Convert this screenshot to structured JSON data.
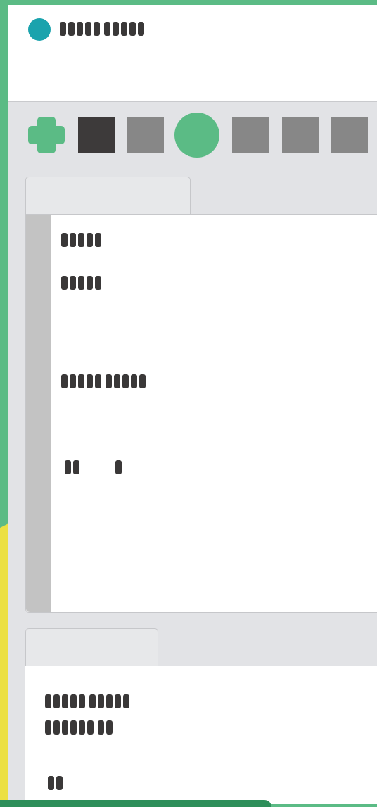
{
  "window": {
    "title": "▮▮▮▮▮ ▮▮▮▮▮",
    "title_pills": [
      5,
      5
    ]
  },
  "toolbar": {
    "tools": [
      {
        "icon": "plus-icon",
        "color": "#5bbb85"
      },
      {
        "icon": "square-dark-icon",
        "color": "#3d3a3a"
      },
      {
        "icon": "square-gray-icon",
        "color": "#878787"
      },
      {
        "icon": "circle-icon",
        "color": "#5bbb85"
      },
      {
        "icon": "square-gray-icon",
        "color": "#878787"
      },
      {
        "icon": "square-gray-icon",
        "color": "#878787"
      },
      {
        "icon": "square-gray-icon",
        "color": "#878787"
      }
    ]
  },
  "panel1": {
    "tab_label": "",
    "lines": [
      {
        "text": "▮▮▮▮▮",
        "pills": [
          5
        ]
      },
      {
        "text": "▮▮▮▮▮",
        "pills": [
          5
        ]
      },
      {
        "text": "▮▮▮▮▮ ▮▮▮▮▮",
        "pills": [
          5,
          5
        ]
      },
      {
        "text": "▮▮ ▮",
        "pills": [
          2,
          "gap",
          1
        ]
      }
    ]
  },
  "panel2": {
    "tab_label": "",
    "lines": [
      {
        "text": "▮▮▮▮▮ ▮▮▮▮▮",
        "pills": [
          5,
          5
        ]
      },
      {
        "text": "▮▮▮▮▮▮ ▮▮",
        "pills": [
          6,
          2
        ]
      },
      {
        "text": "▮▮",
        "pills": [
          2
        ]
      }
    ]
  },
  "colors": {
    "background": "#5bbb85",
    "accent_yellow": "#ece042",
    "title_dot": "#1aa3ad",
    "text": "#3a3838"
  }
}
